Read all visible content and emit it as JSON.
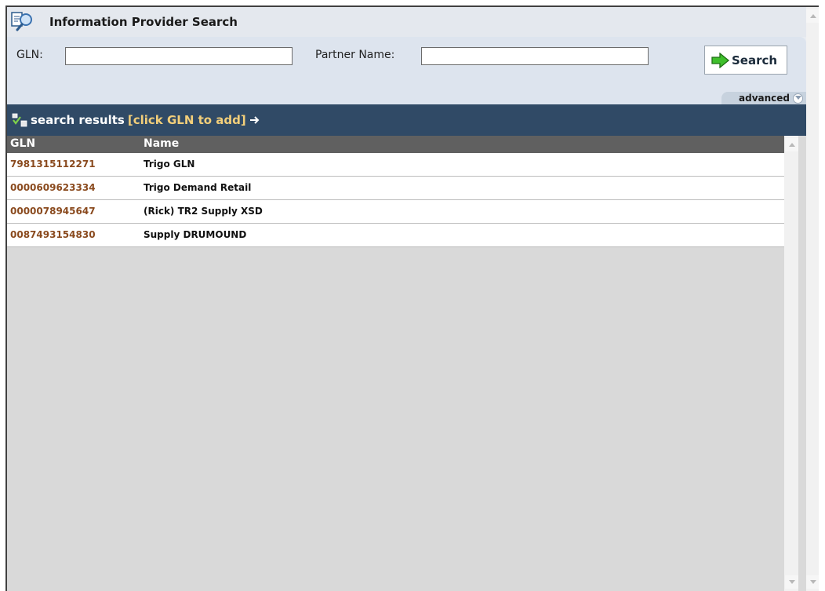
{
  "panel": {
    "title": "Information Provider Search"
  },
  "form": {
    "gln_label": "GLN:",
    "gln_value": "",
    "partner_label": "Partner Name:",
    "partner_value": "",
    "search_label": "Search",
    "advanced_label": "advanced"
  },
  "results": {
    "title": "search results",
    "hint": "[click GLN to add]",
    "columns": {
      "gln": "GLN",
      "name": "Name"
    },
    "rows": [
      {
        "gln": "7981315112271",
        "name": "Trigo GLN"
      },
      {
        "gln": "0000609623334",
        "name": "Trigo Demand Retail"
      },
      {
        "gln": "0000078945647",
        "name": "(Rick) TR2 Supply XSD"
      },
      {
        "gln": "0087493154830",
        "name": "Supply DRUMOUND"
      }
    ]
  },
  "colors": {
    "results_bar": "#304a66",
    "hint": "#f3cf7a",
    "gln_link": "#8a4a1e",
    "table_header": "#606060"
  }
}
